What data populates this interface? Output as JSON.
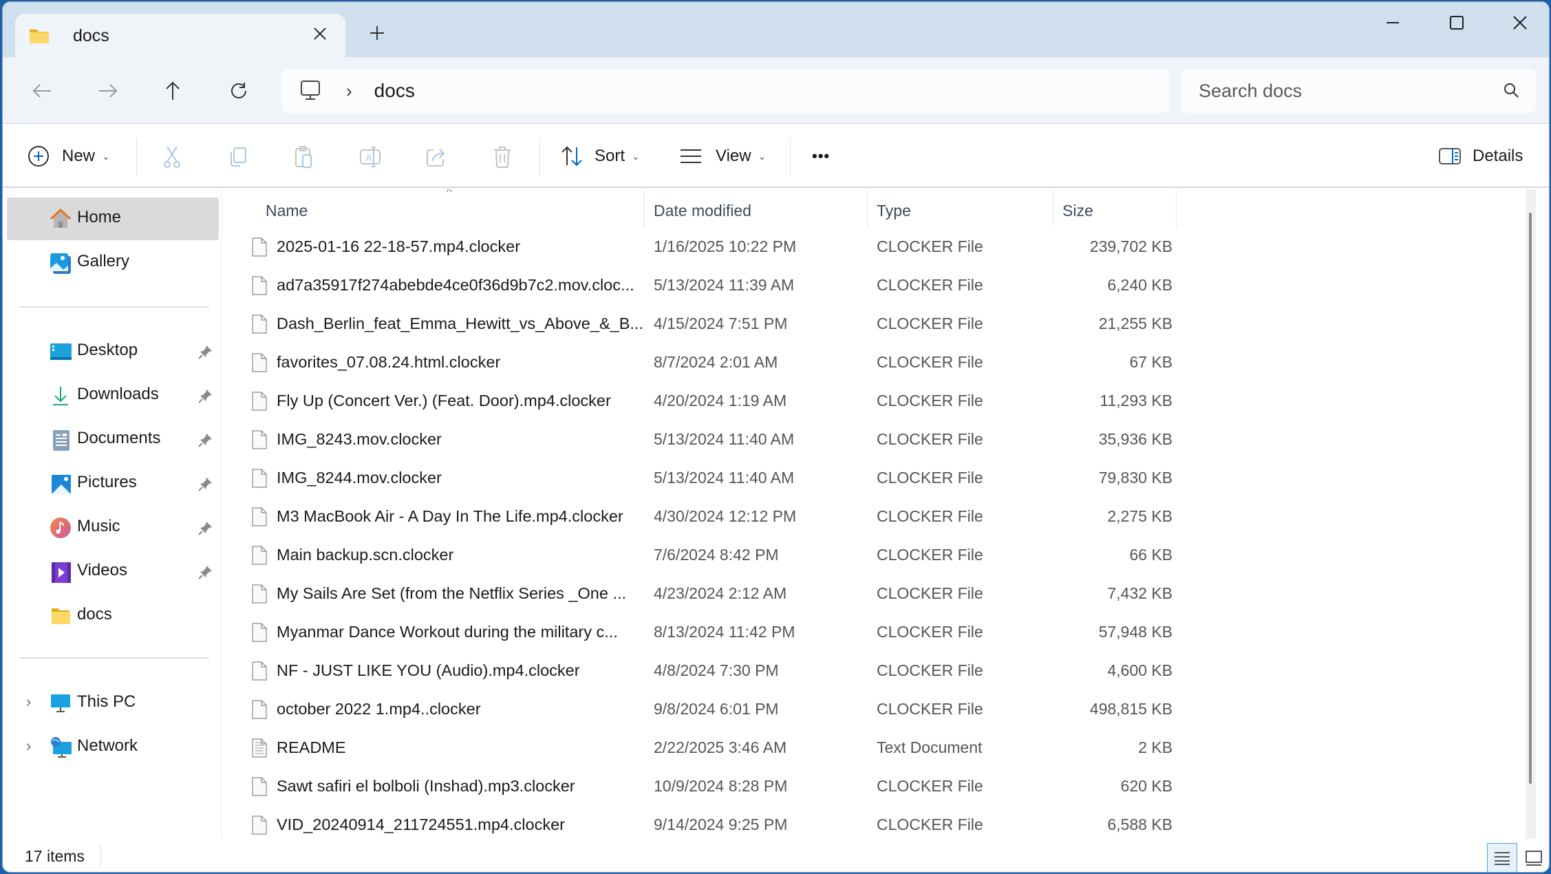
{
  "window": {
    "tab_title": "docs",
    "new_tab_label": "+",
    "close_tab_label": "×"
  },
  "nav": {
    "breadcrumb": [
      "docs"
    ],
    "breadcrumb_separator": "›",
    "search_placeholder": "Search docs"
  },
  "commands": {
    "new_label": "New",
    "sort_label": "Sort",
    "view_label": "View",
    "more_label": "•••",
    "details_label": "Details",
    "icons": [
      "cut-icon",
      "copy-icon",
      "paste-icon",
      "rename-icon",
      "share-icon",
      "delete-icon"
    ]
  },
  "sidebar": {
    "top": [
      {
        "label": "Home",
        "icon": "home-icon",
        "active": true
      },
      {
        "label": "Gallery",
        "icon": "gallery-icon",
        "active": false
      }
    ],
    "quick_access": [
      {
        "label": "Desktop",
        "icon": "desktop-icon",
        "pinned": true
      },
      {
        "label": "Downloads",
        "icon": "downloads-icon",
        "pinned": true
      },
      {
        "label": "Documents",
        "icon": "documents-icon",
        "pinned": true
      },
      {
        "label": "Pictures",
        "icon": "pictures-icon",
        "pinned": true
      },
      {
        "label": "Music",
        "icon": "music-icon",
        "pinned": true
      },
      {
        "label": "Videos",
        "icon": "videos-icon",
        "pinned": true
      },
      {
        "label": "docs",
        "icon": "folder-icon",
        "pinned": false
      }
    ],
    "locations": [
      {
        "label": "This PC",
        "icon": "this-pc-icon"
      },
      {
        "label": "Network",
        "icon": "network-icon"
      }
    ],
    "expander": "›"
  },
  "columns": {
    "name": "Name",
    "date": "Date modified",
    "type": "Type",
    "size": "Size",
    "sort_caret": "^"
  },
  "files": [
    {
      "name": "2025-01-16 22-18-57.mp4.clocker",
      "date": "1/16/2025 10:22 PM",
      "type": "CLOCKER File",
      "size": "239,702 KB",
      "icon": "file-icon"
    },
    {
      "name": "ad7a35917f274abebde4ce0f36d9b7c2.mov.cloc...",
      "date": "5/13/2024 11:39 AM",
      "type": "CLOCKER File",
      "size": "6,240 KB",
      "icon": "file-icon"
    },
    {
      "name": "Dash_Berlin_feat_Emma_Hewitt_vs_Above_&_B...",
      "date": "4/15/2024 7:51 PM",
      "type": "CLOCKER File",
      "size": "21,255 KB",
      "icon": "file-icon"
    },
    {
      "name": "favorites_07.08.24.html.clocker",
      "date": "8/7/2024 2:01 AM",
      "type": "CLOCKER File",
      "size": "67 KB",
      "icon": "file-icon"
    },
    {
      "name": "Fly Up (Concert Ver.) (Feat. Door).mp4.clocker",
      "date": "4/20/2024 1:19 AM",
      "type": "CLOCKER File",
      "size": "11,293 KB",
      "icon": "file-icon"
    },
    {
      "name": "IMG_8243.mov.clocker",
      "date": "5/13/2024 11:40 AM",
      "type": "CLOCKER File",
      "size": "35,936 KB",
      "icon": "file-icon"
    },
    {
      "name": "IMG_8244.mov.clocker",
      "date": "5/13/2024 11:40 AM",
      "type": "CLOCKER File",
      "size": "79,830 KB",
      "icon": "file-icon"
    },
    {
      "name": "M3 MacBook Air - A Day In The Life.mp4.clocker",
      "date": "4/30/2024 12:12 PM",
      "type": "CLOCKER File",
      "size": "2,275 KB",
      "icon": "file-icon"
    },
    {
      "name": "Main backup.scn.clocker",
      "date": "7/6/2024 8:42 PM",
      "type": "CLOCKER File",
      "size": "66 KB",
      "icon": "file-icon"
    },
    {
      "name": "My Sails Are Set (from the Netflix Series _One ...",
      "date": "4/23/2024 2:12 AM",
      "type": "CLOCKER File",
      "size": "7,432 KB",
      "icon": "file-icon"
    },
    {
      "name": "Myanmar Dance Workout during the military c...",
      "date": "8/13/2024 11:42 PM",
      "type": "CLOCKER File",
      "size": "57,948 KB",
      "icon": "file-icon"
    },
    {
      "name": "NF - JUST LIKE YOU (Audio).mp4.clocker",
      "date": "4/8/2024 7:30 PM",
      "type": "CLOCKER File",
      "size": "4,600 KB",
      "icon": "file-icon"
    },
    {
      "name": "october 2022 1.mp4..clocker",
      "date": "9/8/2024 6:01 PM",
      "type": "CLOCKER File",
      "size": "498,815 KB",
      "icon": "file-icon"
    },
    {
      "name": "README",
      "date": "2/22/2025 3:46 AM",
      "type": "Text Document",
      "size": "2 KB",
      "icon": "text-file-icon"
    },
    {
      "name": "Sawt safiri el bolboli (Inshad).mp3.clocker",
      "date": "10/9/2024 8:28 PM",
      "type": "CLOCKER File",
      "size": "620 KB",
      "icon": "file-icon"
    },
    {
      "name": "VID_20240914_211724551.mp4.clocker",
      "date": "9/14/2024 9:25 PM",
      "type": "CLOCKER File",
      "size": "6,588 KB",
      "icon": "file-icon"
    }
  ],
  "status": {
    "item_count": "17 items"
  },
  "colors": {
    "accent": "#0067c0",
    "titlebar": "#d0dfed",
    "navbar": "#eff4f9",
    "selected_sidebar": "#dadada"
  }
}
